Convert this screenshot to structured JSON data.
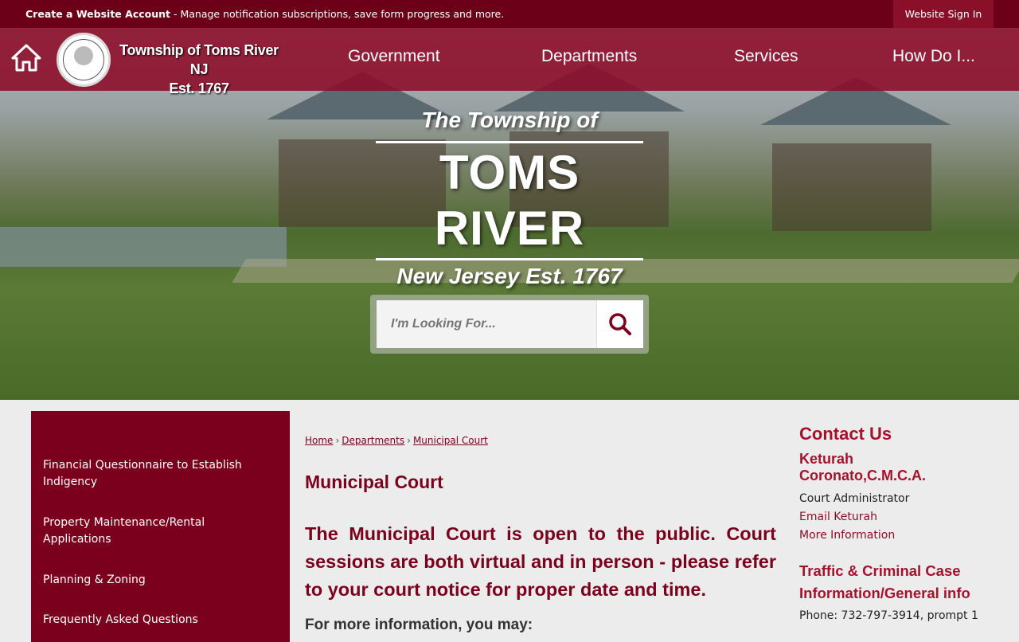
{
  "topbar": {
    "create_account": "Create a Website Account",
    "message": " - Manage notification subscriptions, save form progress and more.",
    "sign_in": "Website Sign In"
  },
  "header": {
    "brand_line1": "Township of Toms River  NJ",
    "brand_line2": "Est. 1767",
    "nav": [
      "Government",
      "Departments",
      "Services",
      "How Do I..."
    ]
  },
  "hero": {
    "line1": "The Township of",
    "line2": "TOMS RIVER",
    "line3": "New Jersey Est. 1767"
  },
  "search": {
    "placeholder": "I'm Looking For..."
  },
  "sidebar": {
    "items": [
      "Financial Questionnaire to Establish Indigency",
      "Property Maintenance/Rental Applications",
      "Planning & Zoning",
      "Frequently Asked Questions"
    ]
  },
  "breadcrumb": [
    "Home",
    "Departments",
    "Municipal Court"
  ],
  "main": {
    "title": "Municipal Court",
    "notice": "The Municipal Court is open to the public. Court sessions are both virtual and in person - please refer to your court notice for proper date and time.",
    "more_info": "For more information, you may:"
  },
  "contact": {
    "heading": "Contact Us",
    "name": "Keturah Coronato,C.M.C.A.",
    "role": "Court Administrator",
    "email_link": "Email Keturah",
    "more_link": "More Information",
    "section2_heading": "Traffic & Criminal Case Information/General info",
    "phone": "Phone: 732-797-3914, prompt 1"
  },
  "colors": {
    "brand_dark": "#6d0019",
    "brand": "#7a001e",
    "accent_red": "#a5122e"
  }
}
